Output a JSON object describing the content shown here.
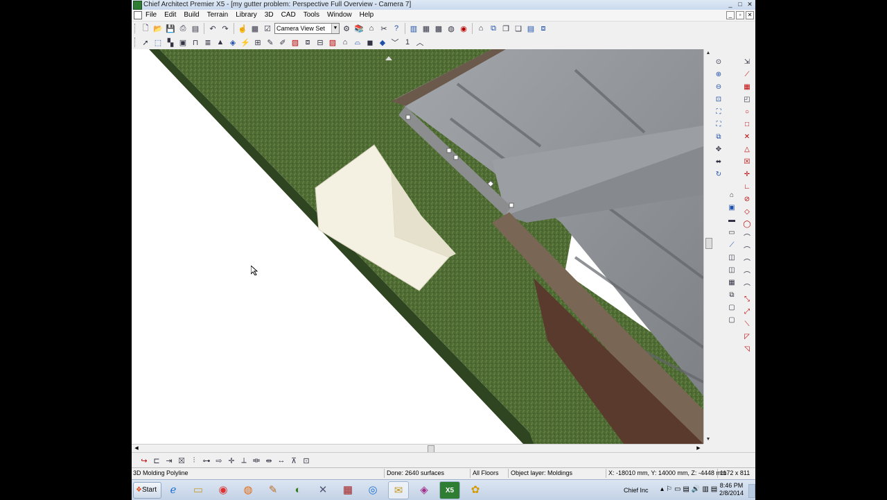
{
  "window": {
    "title": "Chief Architect Premier X5 - [my gutter problem: Perspective Full Overview - Camera 7]"
  },
  "window_buttons": {
    "minimize": "_",
    "restore": "□",
    "close": "✕"
  },
  "menu": [
    "File",
    "Edit",
    "Build",
    "Terrain",
    "Library",
    "3D",
    "CAD",
    "Tools",
    "Window",
    "Help"
  ],
  "toolbar": {
    "camera_view_set": "Camera View Set",
    "floor_number": "1"
  },
  "status": {
    "message": "3D Molding Polyline",
    "done": "Done:  2640 surfaces",
    "floors": "All Floors",
    "layer": "Object layer: Moldings",
    "coords": "X: -18010 mm, Y: 14000 mm, Z: -4448 mm",
    "size": "1172 x 811"
  },
  "taskbar": {
    "start_label": "Start",
    "active_app_label": "X5",
    "tray_label": "Chief Inc",
    "time": "8:46 PM",
    "date": "2/8/2014"
  },
  "colors": {
    "grass": "#4f6b34",
    "roof": "#8f9397",
    "gutter": "#6b5a4b",
    "fascia": "#5a3a2d"
  }
}
